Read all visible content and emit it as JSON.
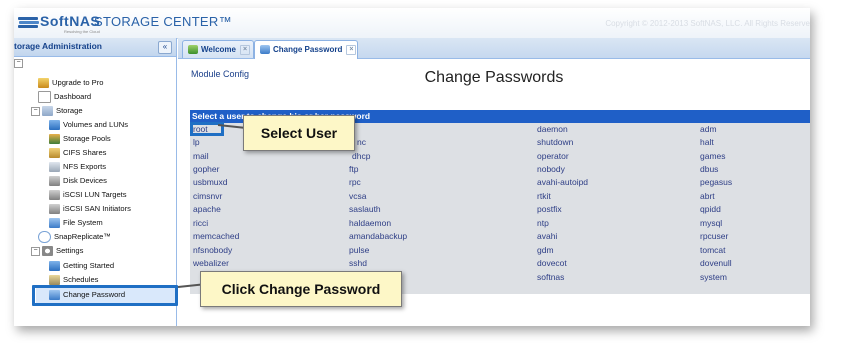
{
  "app": {
    "brand": "SoftNAS",
    "tagline": "Resolving the Cloud",
    "product": "STORAGE CENTER™",
    "copyright": "Copyright © 2012-2013 SoftNAS, LLC. All Rights Reserve"
  },
  "sidebar": {
    "title": "torage Administration",
    "collapse_label": "«",
    "items": [
      {
        "label": "Upgrade to Pro",
        "icon": "upgrade-icon"
      },
      {
        "label": "Dashboard",
        "icon": "dashboard-icon"
      },
      {
        "label": "Storage",
        "icon": "storage-folder-icon"
      },
      {
        "label": "Volumes and LUNs",
        "icon": "volumes-icon"
      },
      {
        "label": "Storage Pools",
        "icon": "storage-pools-icon"
      },
      {
        "label": "CIFS Shares",
        "icon": "cifs-icon"
      },
      {
        "label": "NFS Exports",
        "icon": "nfs-icon"
      },
      {
        "label": "Disk Devices",
        "icon": "disk-icon"
      },
      {
        "label": "iSCSI LUN Targets",
        "icon": "iscsi-lun-icon"
      },
      {
        "label": "iSCSI SAN Initiators",
        "icon": "iscsi-san-icon"
      },
      {
        "label": "File System",
        "icon": "filesystem-icon"
      },
      {
        "label": "SnapReplicate™",
        "icon": "snapreplicate-icon"
      },
      {
        "label": "Settings",
        "icon": "settings-icon"
      },
      {
        "label": "Getting Started",
        "icon": "getting-started-icon"
      },
      {
        "label": "Schedules",
        "icon": "schedules-icon"
      },
      {
        "label": "Change Password",
        "icon": "change-password-icon"
      }
    ]
  },
  "tabs": [
    {
      "label": "Welcome",
      "icon": "welcome-icon"
    },
    {
      "label": "Change Password",
      "icon": "password-tab-icon"
    }
  ],
  "main": {
    "module_config": "Module Config",
    "heading": "Change Passwords",
    "section_header": "Select a user to change his or her password",
    "users": [
      [
        "root",
        "",
        "daemon",
        "adm"
      ],
      [
        "lp",
        "nc",
        "shutdown",
        "halt"
      ],
      [
        "mail",
        "dhcp",
        "operator",
        "games"
      ],
      [
        "gopher",
        "ftp",
        "nobody",
        "dbus"
      ],
      [
        "usbmuxd",
        "rpc",
        "avahi-autoipd",
        "pegasus"
      ],
      [
        "cimsnvr",
        "vcsa",
        "rtkit",
        "abrt"
      ],
      [
        "apache",
        "saslauth",
        "postfix",
        "qpidd"
      ],
      [
        "ricci",
        "haldaemon",
        "ntp",
        "mysql"
      ],
      [
        "memcached",
        "amandabackup",
        "avahi",
        "rpcuser"
      ],
      [
        "nfsnobody",
        "pulse",
        "gdm",
        "tomcat"
      ],
      [
        "webalizer",
        "sshd",
        "dovecot",
        "dovenull"
      ],
      [
        "",
        "",
        "softnas",
        "system"
      ]
    ]
  },
  "callouts": {
    "select_user": "Select User",
    "click_change_password": "Click Change Password"
  },
  "colors": {
    "accent": "#1f5fc7",
    "callout_bg": "#fdf7c7",
    "highlight_border": "#1f6fc4"
  }
}
